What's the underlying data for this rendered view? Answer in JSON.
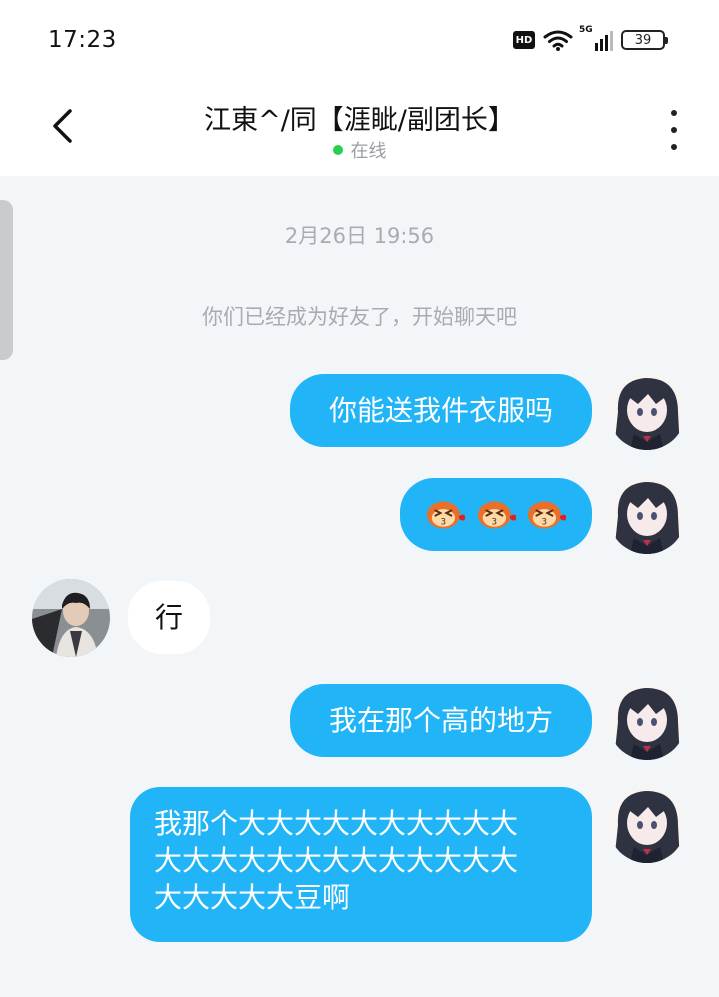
{
  "status_bar": {
    "time": "17:23",
    "hd_label": "HD",
    "network_label": "5G",
    "battery_level": "39"
  },
  "header": {
    "title": "江東^/同【涯眦/副团长】",
    "presence_text": "在线",
    "presence_color": "#2bcf4f"
  },
  "conversation": {
    "timestamp": "2月26日 19:56",
    "system_note": "你们已经成为好友了，开始聊天吧",
    "messages": [
      {
        "direction": "out",
        "type": "text",
        "text": "你能送我件衣服吗"
      },
      {
        "direction": "out",
        "type": "sticker",
        "sticker_name": "laughing-monkey-emoji",
        "count": 3
      },
      {
        "direction": "in",
        "type": "text",
        "text": "行"
      },
      {
        "direction": "out",
        "type": "text",
        "text": "我在那个高的地方"
      },
      {
        "direction": "out",
        "type": "text",
        "lines": [
          "我那个大大大大大大大大大大",
          "大大大大大大大大大大大大大",
          "大大大大大豆啊"
        ]
      }
    ]
  },
  "colors": {
    "outgoing_bubble": "#21b5f7",
    "incoming_bubble": "#ffffff",
    "background": "#f3f6f9"
  }
}
